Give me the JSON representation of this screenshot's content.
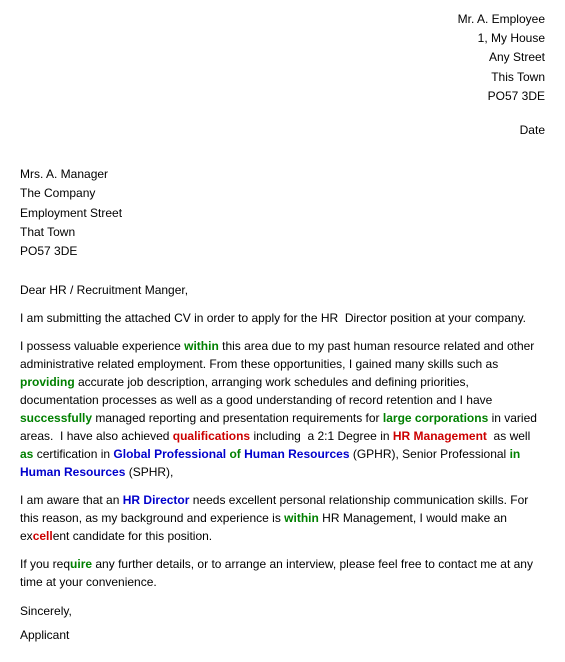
{
  "sender": {
    "name": "Mr. A. Employee",
    "house": "1, My House",
    "street": "Any Street",
    "town": "This Town",
    "postcode": "PO57 3DE"
  },
  "date_label": "Date",
  "recipient": {
    "name": "Mrs. A. Manager",
    "company": "The Company",
    "street": "Employment Street",
    "town": "That Town",
    "postcode": "PO57 3DE"
  },
  "salutation": "Dear HR / Recruitment Manger,",
  "paragraphs": {
    "intro": "I am submitting the attached CV in order to apply for the HR  Director position at your company.",
    "experience_start": "I possess valuable experience within this area due to my past human resource related and other administrative related employment. From these opportunities, I gained many skills such as providing accurate job description, arranging work schedules and defining priorities, documentation processes as well as a good understanding of record retention and I have successfully managed reporting and presentation requirements for large corporations in varied areas.  I have also achieved qualifications including  a 2:1 Degree in HR Management  as well  as certification in Global Professional of Human Resources (GPHR), Senior Professional in Human Resources (SPHR),",
    "awareness": "I am aware that an HR Director needs excellent personal relationship communication skills. For this reason, as my background and experience is within HR Management, I would make an excellent candidate for this position.",
    "closing_para": "If you require any further details, or to arrange an interview, please feel free to contact me at any time at your convenience."
  },
  "closing": "Sincerely,",
  "applicant": "Applicant"
}
